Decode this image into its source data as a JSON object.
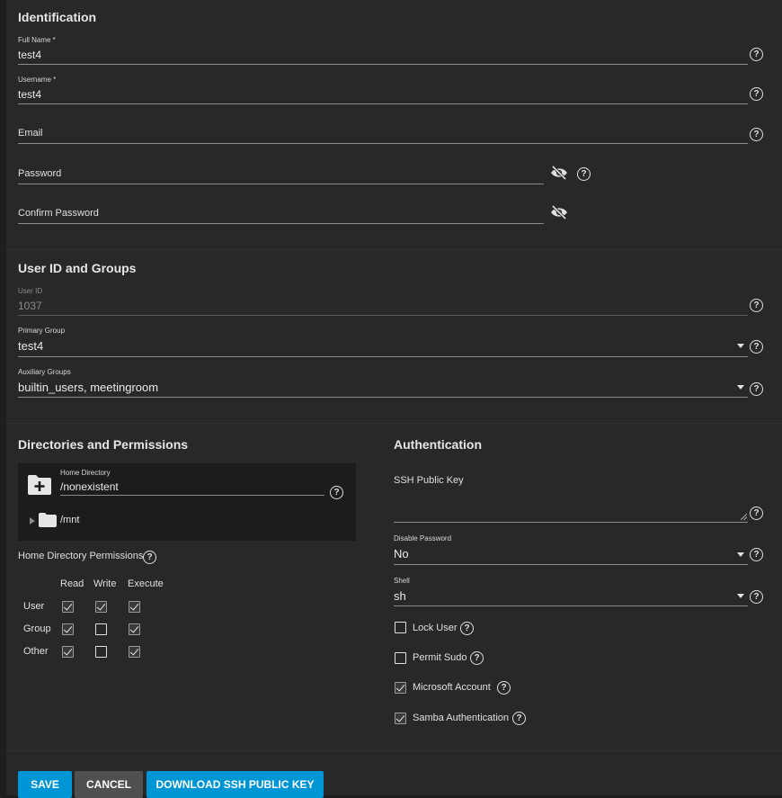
{
  "identification": {
    "title": "Identification",
    "full_name": {
      "label": "Full Name *",
      "value": "test4"
    },
    "username": {
      "label": "Username *",
      "value": "test4"
    },
    "email": {
      "label": "Email",
      "value": ""
    },
    "password": {
      "label": "Password",
      "value": ""
    },
    "confirm_password": {
      "label": "Confirm Password",
      "value": ""
    }
  },
  "user_id_groups": {
    "title": "User ID and Groups",
    "user_id": {
      "label": "User ID",
      "value": "1037"
    },
    "primary_group": {
      "label": "Primary Group",
      "value": "test4"
    },
    "auxiliary_groups": {
      "label": "Auxiliary Groups",
      "value": "builtin_users, meetingroom"
    }
  },
  "directories": {
    "title": "Directories and Permissions",
    "home_directory": {
      "label": "Home Directory",
      "value": "/nonexistent"
    },
    "tree_root": "/mnt",
    "permissions_title": "Home Directory Permissions",
    "columns": [
      "Read",
      "Write",
      "Execute"
    ],
    "rows": [
      {
        "label": "User",
        "read": true,
        "write": true,
        "execute": true
      },
      {
        "label": "Group",
        "read": true,
        "write": false,
        "execute": true
      },
      {
        "label": "Other",
        "read": true,
        "write": false,
        "execute": true
      }
    ]
  },
  "authentication": {
    "title": "Authentication",
    "ssh_public_key": {
      "label": "SSH Public Key",
      "value": ""
    },
    "disable_password": {
      "label": "Disable Password",
      "value": "No"
    },
    "shell": {
      "label": "Shell",
      "value": "sh"
    },
    "checkboxes": [
      {
        "label": "Lock User",
        "checked": false
      },
      {
        "label": "Permit Sudo",
        "checked": false
      },
      {
        "label": "Microsoft Account",
        "checked": true
      },
      {
        "label": "Samba Authentication",
        "checked": true
      }
    ]
  },
  "actions": {
    "save": "SAVE",
    "cancel": "CANCEL",
    "download_ssh": "DOWNLOAD SSH PUBLIC KEY"
  },
  "colors": {
    "primary_button": "#0095d5",
    "secondary_button": "#505050",
    "background": "#282828"
  }
}
